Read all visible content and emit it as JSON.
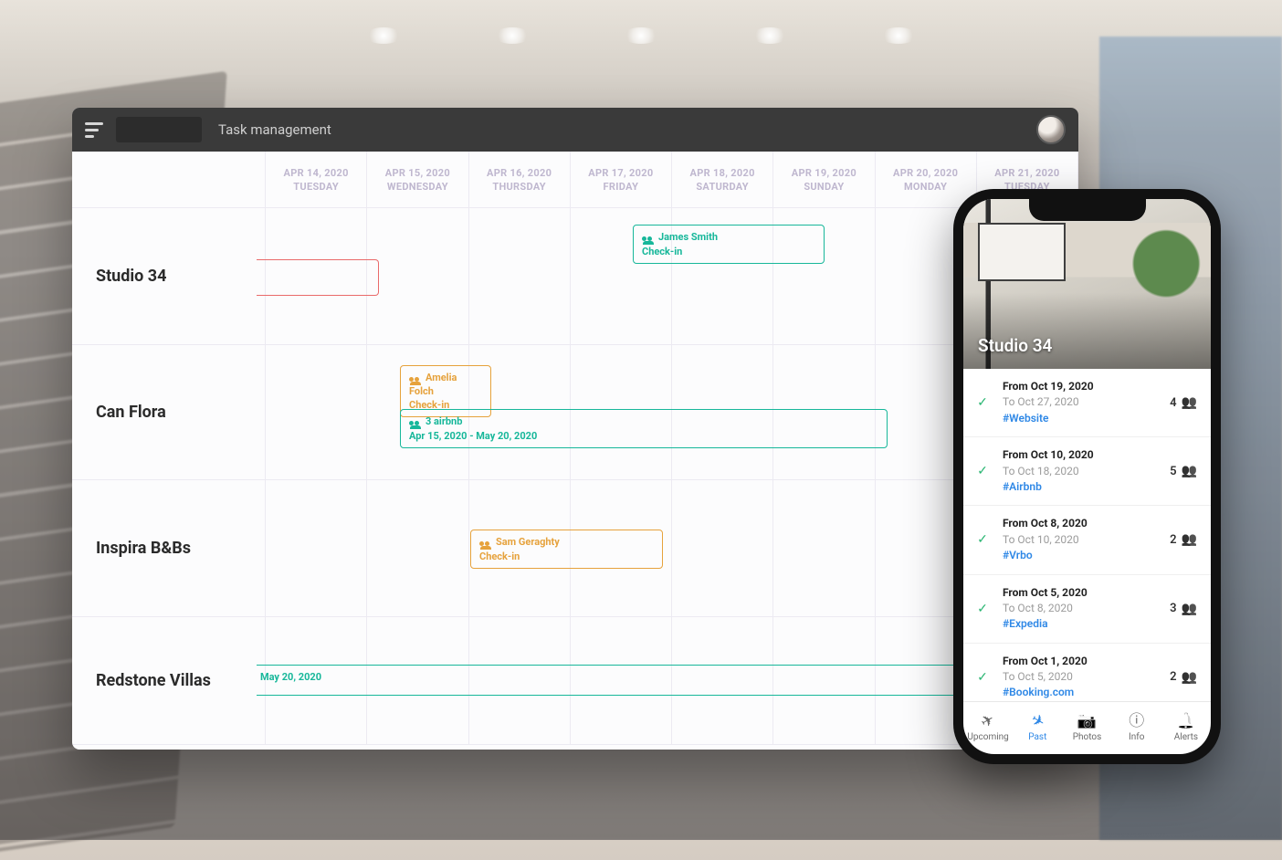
{
  "app": {
    "title": "Task management",
    "columns": [
      {
        "date": "APR 14, 2020",
        "day": "TUESDAY"
      },
      {
        "date": "APR 15, 2020",
        "day": "WEDNESDAY"
      },
      {
        "date": "APR 16, 2020",
        "day": "THURSDAY"
      },
      {
        "date": "APR 17, 2020",
        "day": "FRIDAY"
      },
      {
        "date": "APR 18, 2020",
        "day": "SATURDAY"
      },
      {
        "date": "APR 19, 2020",
        "day": "SUNDAY"
      },
      {
        "date": "APR 20, 2020",
        "day": "MONDAY"
      },
      {
        "date": "APR 21, 2020",
        "day": "TUESDAY"
      }
    ],
    "properties": [
      {
        "name": "Studio 34"
      },
      {
        "name": "Can Flora"
      },
      {
        "name": "Inspira B&Bs"
      },
      {
        "name": "Redstone Villas"
      }
    ],
    "events": {
      "studio34_checkin": {
        "guest": "James Smith",
        "sub": "Check-in"
      },
      "canflora_amelia": {
        "guest": "Amelia Folch",
        "sub": "Check-in"
      },
      "canflora_airbnb": {
        "guest": "3 airbnb",
        "sub": "Apr 15, 2020 - May 20, 2020"
      },
      "inspira_sam": {
        "guest": "Sam Geraghty",
        "sub": "Check-in"
      },
      "redstone_strip": {
        "text": "May 20, 2020"
      }
    }
  },
  "phone": {
    "property": "Studio 34",
    "reservations": [
      {
        "from": "From Oct 19, 2020",
        "to": "To Oct 27, 2020",
        "source": "#Website",
        "guests": "4"
      },
      {
        "from": "From Oct 10, 2020",
        "to": "To Oct 18, 2020",
        "source": "#Airbnb",
        "guests": "5"
      },
      {
        "from": "From Oct 8, 2020",
        "to": "To Oct 10, 2020",
        "source": "#Vrbo",
        "guests": "2"
      },
      {
        "from": "From Oct 5, 2020",
        "to": "To Oct 8, 2020",
        "source": "#Expedia",
        "guests": "3"
      },
      {
        "from": "From Oct 1, 2020",
        "to": "To Oct 5, 2020",
        "source": "#Booking.com",
        "guests": "2"
      }
    ],
    "tabs": [
      {
        "label": "Upcoming"
      },
      {
        "label": "Past"
      },
      {
        "label": "Photos"
      },
      {
        "label": "Info"
      },
      {
        "label": "Alerts"
      }
    ]
  }
}
